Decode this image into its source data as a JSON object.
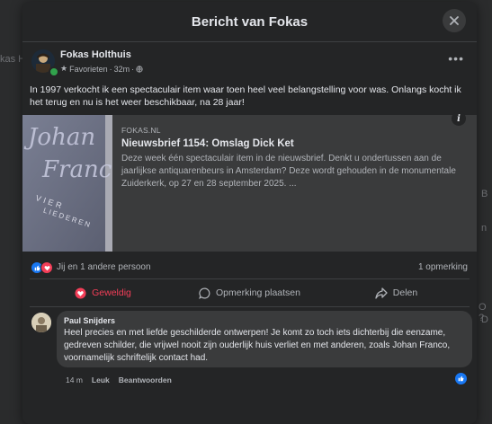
{
  "background": {
    "left_fragment": "kas H",
    "right_fragment_1": "B",
    "right_fragment_2": "n",
    "right_fragment_3": "O ?",
    "right_fragment_4": "D"
  },
  "modal": {
    "title": "Bericht van Fokas"
  },
  "post": {
    "author": "Fokas Holthuis",
    "audience": "Favorieten",
    "time": "32m",
    "text": "In 1997 verkocht ik een spectaculair item waar toen heel veel belangstelling voor was. Onlangs kocht ik het terug en nu is het weer beschikbaar, na 28 jaar!",
    "link": {
      "source": "FOKAS.NL",
      "title": "Nieuwsbrief 1154: Omslag Dick Ket",
      "description": "Deze week één spectaculair item in de nieuwsbrief. Denkt u ondertussen aan de jaarlijkse antiquarenbeurs in Amsterdam? Deze wordt gehouden in de monumentale Zuiderkerk, op 27 en 28 september 2025. ..."
    },
    "thumbnail": {
      "line1": "Johan",
      "line2": "Franco",
      "line3": "VIER",
      "line4": "LIEDEREN"
    },
    "reactions_text": "Jij en 1 andere persoon",
    "comment_count": "1 opmerking"
  },
  "actions": {
    "like": "Geweldig",
    "comment": "Opmerking plaatsen",
    "share": "Delen"
  },
  "comment": {
    "author": "Paul Snijders",
    "text": "Heel precies en met liefde geschilderde ontwerpen! Je komt zo toch iets dichterbij die eenzame, gedreven schilder, die vrijwel nooit zijn ouderlijk huis verliet en met anderen, zoals Johan Franco, voornamelijk schriftelijk contact had.",
    "time": "14 m",
    "like_label": "Leuk",
    "reply_label": "Beantwoorden"
  },
  "colors": {
    "accent_blue": "#1877f2",
    "love_red": "#f33e58",
    "online_green": "#31a24c"
  }
}
